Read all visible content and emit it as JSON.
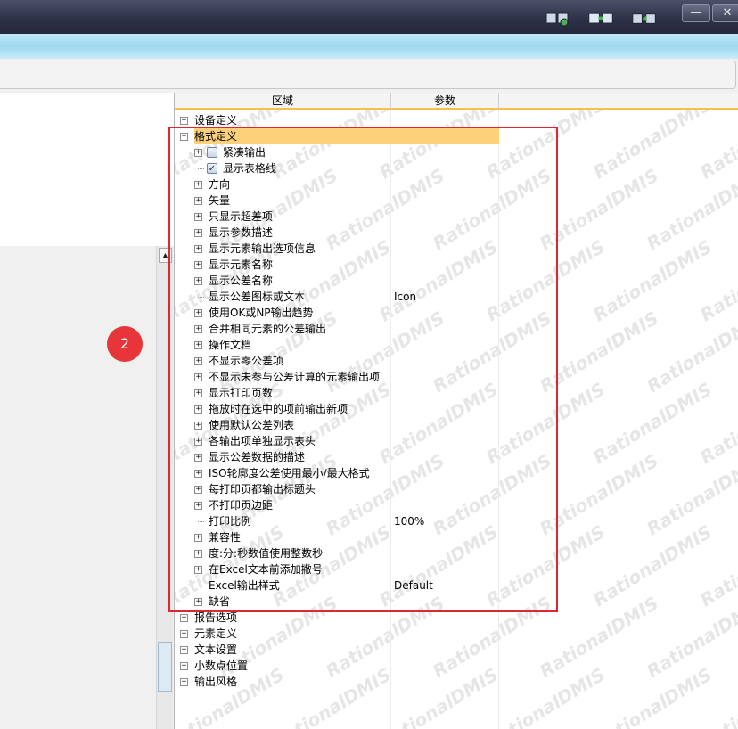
{
  "grid": {
    "columns": [
      "区域",
      "参数"
    ],
    "rows": [
      {
        "label": "设备定义",
        "level": 0,
        "kind": "expand",
        "value": ""
      },
      {
        "label": "格式定义",
        "level": 0,
        "kind": "collapse",
        "value": "",
        "selected": true
      },
      {
        "label": "紧凑输出",
        "level": 1,
        "kind": "expand-check",
        "checked": false,
        "value": ""
      },
      {
        "label": "显示表格线",
        "level": 1,
        "kind": "check",
        "checked": true,
        "value": ""
      },
      {
        "label": "方向",
        "level": 1,
        "kind": "expand",
        "value": ""
      },
      {
        "label": "矢量",
        "level": 1,
        "kind": "expand",
        "value": ""
      },
      {
        "label": "只显示超差项",
        "level": 1,
        "kind": "expand",
        "value": ""
      },
      {
        "label": "显示参数描述",
        "level": 1,
        "kind": "expand",
        "value": ""
      },
      {
        "label": "显示元素输出选项信息",
        "level": 1,
        "kind": "expand",
        "value": ""
      },
      {
        "label": "显示元素名称",
        "level": 1,
        "kind": "expand",
        "value": ""
      },
      {
        "label": "显示公差名称",
        "level": 1,
        "kind": "expand",
        "value": ""
      },
      {
        "label": "显示公差图标或文本",
        "level": 1,
        "kind": "leaf",
        "value": "Icon"
      },
      {
        "label": "使用OK或NP输出趋势",
        "level": 1,
        "kind": "expand",
        "value": ""
      },
      {
        "label": "合并相同元素的公差输出",
        "level": 1,
        "kind": "expand",
        "value": ""
      },
      {
        "label": "操作文档",
        "level": 1,
        "kind": "expand",
        "value": ""
      },
      {
        "label": "不显示零公差项",
        "level": 1,
        "kind": "expand",
        "value": ""
      },
      {
        "label": "不显示未参与公差计算的元素输出项",
        "level": 1,
        "kind": "expand",
        "value": ""
      },
      {
        "label": "显示打印页数",
        "level": 1,
        "kind": "expand",
        "value": ""
      },
      {
        "label": "拖放时在选中的项前输出新项",
        "level": 1,
        "kind": "expand",
        "value": ""
      },
      {
        "label": "使用默认公差列表",
        "level": 1,
        "kind": "expand",
        "value": ""
      },
      {
        "label": "各输出项单独显示表头",
        "level": 1,
        "kind": "expand",
        "value": ""
      },
      {
        "label": "显示公差数据的描述",
        "level": 1,
        "kind": "expand",
        "value": ""
      },
      {
        "label": "ISO轮廓度公差使用最小/最大格式",
        "level": 1,
        "kind": "expand",
        "value": ""
      },
      {
        "label": "每打印页都输出标题头",
        "level": 1,
        "kind": "expand",
        "value": ""
      },
      {
        "label": "不打印页边距",
        "level": 1,
        "kind": "expand",
        "value": ""
      },
      {
        "label": "打印比例",
        "level": 1,
        "kind": "leaf",
        "value": "100%"
      },
      {
        "label": "兼容性",
        "level": 1,
        "kind": "expand",
        "value": ""
      },
      {
        "label": "度:分:秒数值使用整数秒",
        "level": 1,
        "kind": "expand",
        "value": ""
      },
      {
        "label": "在Excel文本前添加撇号",
        "level": 1,
        "kind": "expand",
        "value": ""
      },
      {
        "label": "Excel输出样式",
        "level": 1,
        "kind": "leaf",
        "value": "Default"
      },
      {
        "label": "缺省",
        "level": 1,
        "kind": "expand",
        "value": ""
      },
      {
        "label": "报告选项",
        "level": 0,
        "kind": "expand",
        "value": ""
      },
      {
        "label": "元素定义",
        "level": 0,
        "kind": "expand",
        "value": ""
      },
      {
        "label": "文本设置",
        "level": 0,
        "kind": "expand",
        "value": ""
      },
      {
        "label": "小数点位置",
        "level": 0,
        "kind": "expand",
        "value": ""
      },
      {
        "label": "输出风格",
        "level": 0,
        "kind": "expand",
        "value": ""
      }
    ]
  },
  "annotation": {
    "badge": "2"
  },
  "watermark": "RationalDMIS",
  "window": {
    "minimize": "—",
    "close": "✕"
  },
  "colors": {
    "selected": "#fdd07a",
    "highlight_box": "#e0262e",
    "badge": "#e8353a"
  }
}
